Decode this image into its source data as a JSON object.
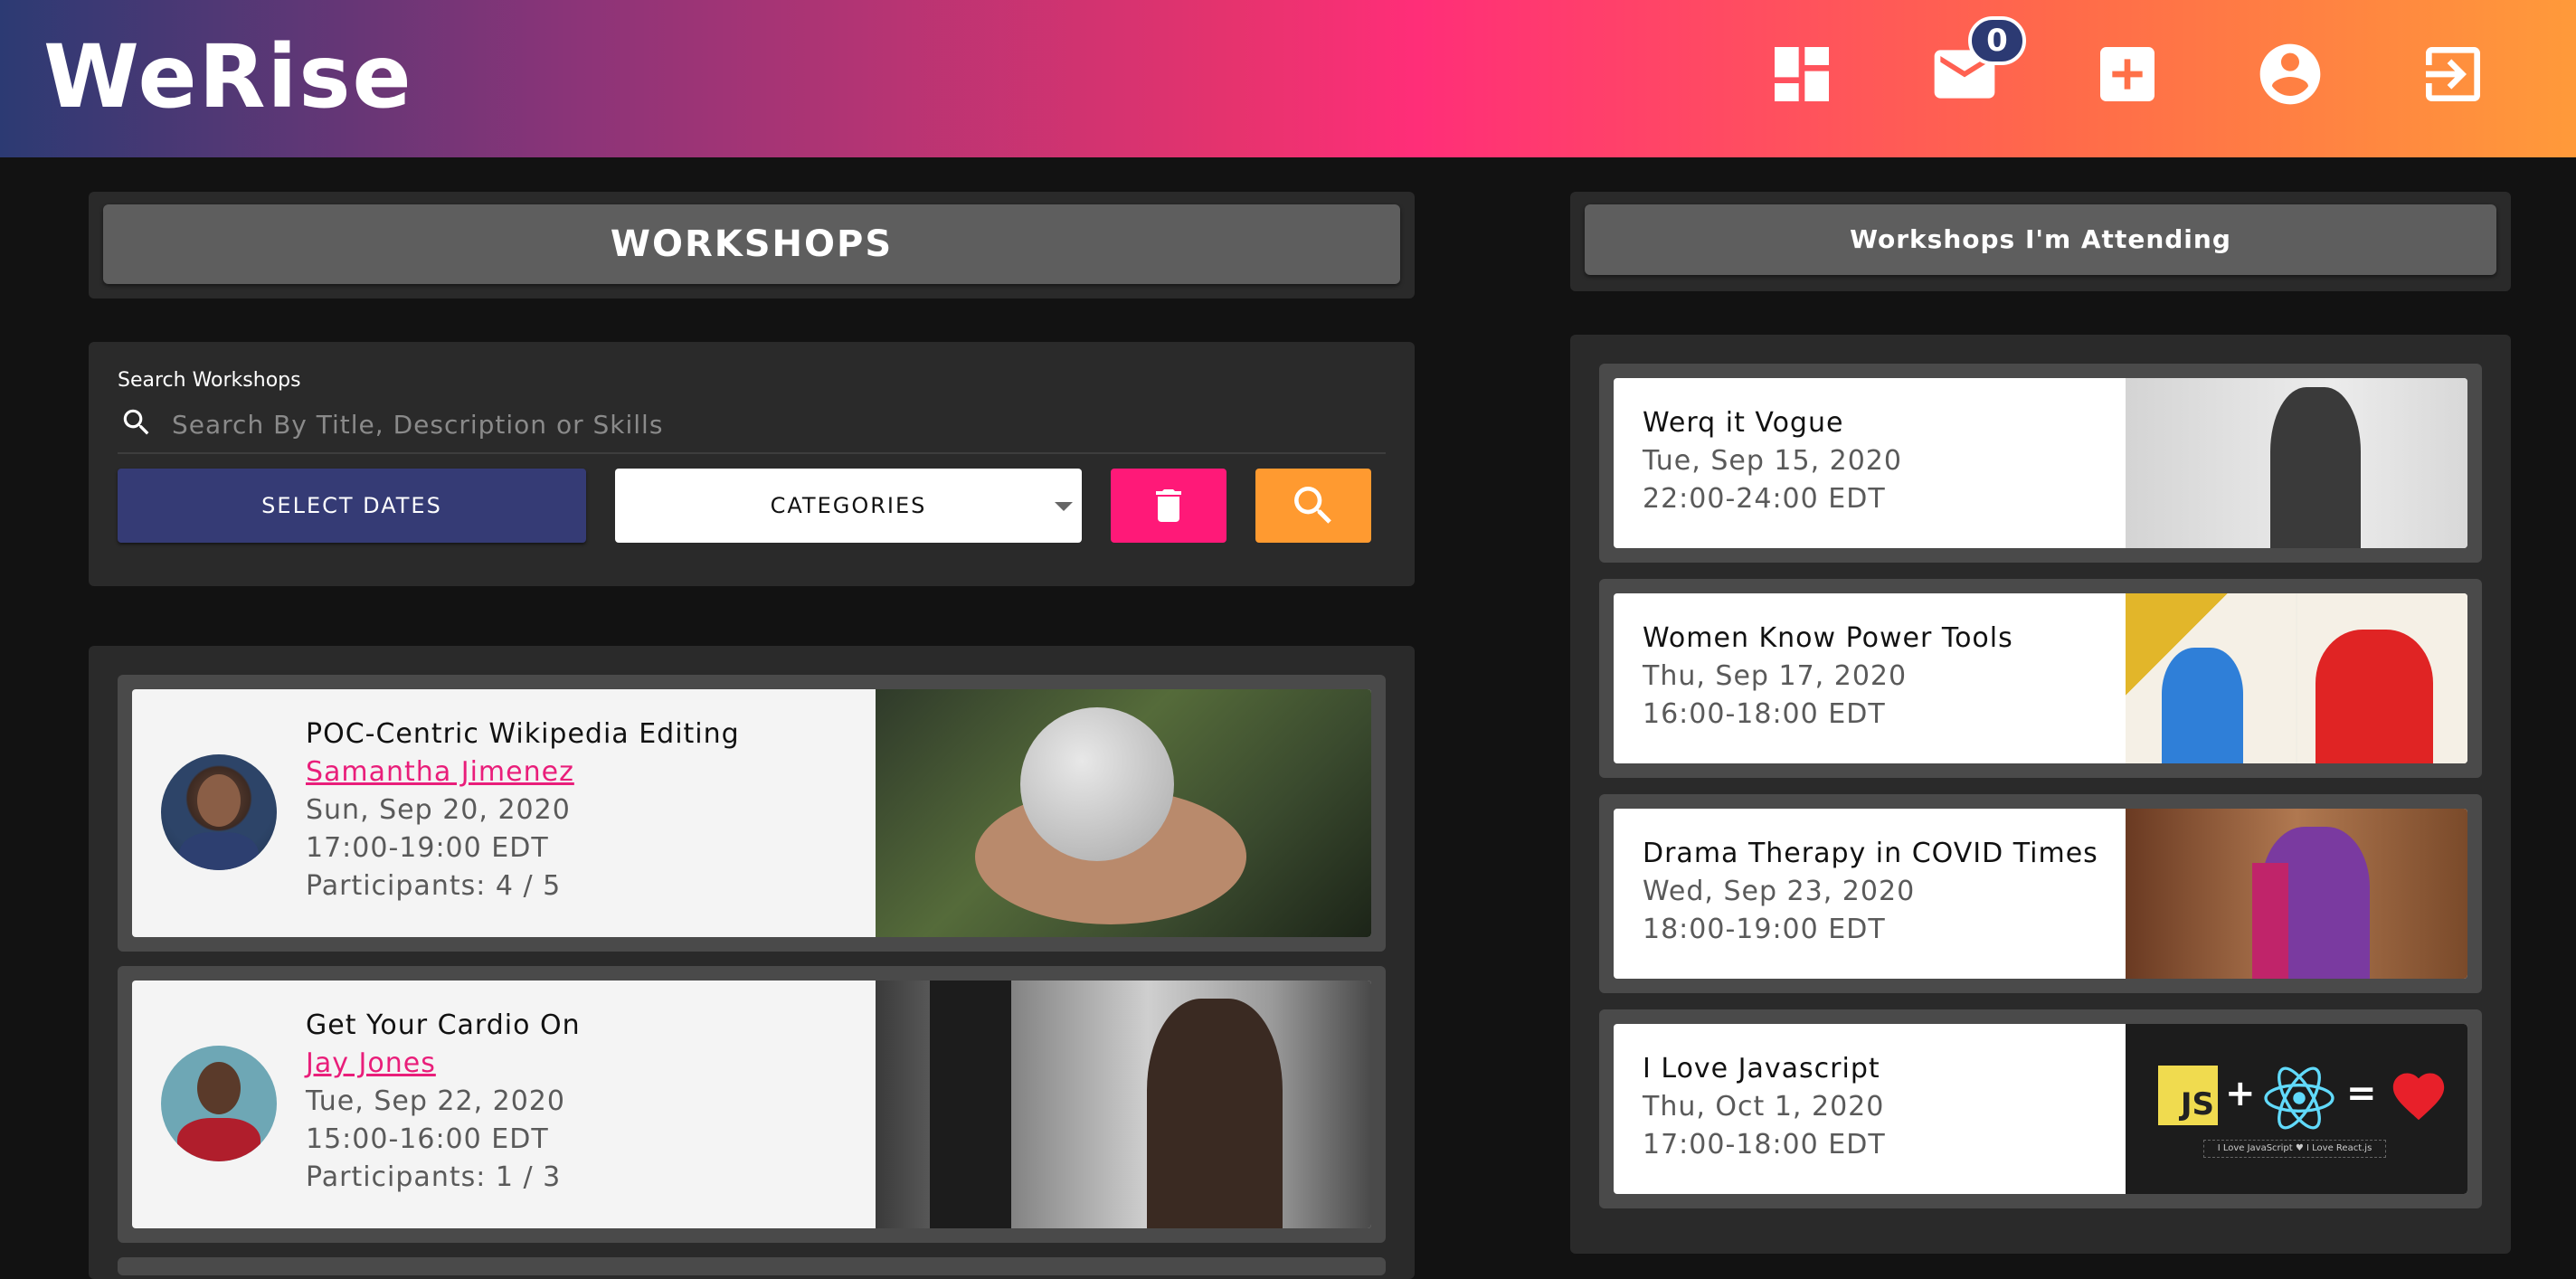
{
  "app": {
    "logo": "WeRise"
  },
  "nav": {
    "icons": [
      "dashboard-icon",
      "mail-icon",
      "add-icon",
      "account-icon",
      "logout-icon"
    ],
    "mail_badge": "0"
  },
  "workshops": {
    "title": "WORKSHOPS",
    "search": {
      "label": "Search Workshops",
      "placeholder": "Search By Title, Description or Skills",
      "value": ""
    },
    "select_dates_label": "SELECT DATES",
    "categories_label": "CATEGORIES",
    "list": [
      {
        "title": "POC-Centric Wikipedia Editing",
        "host": "Samantha Jimenez",
        "date": "Sun, Sep 20, 2020",
        "time": "17:00-19:00 EDT",
        "participants": "Participants: 4 / 5"
      },
      {
        "title": "Get Your Cardio On",
        "host": "Jay Jones",
        "date": "Tue, Sep 22, 2020",
        "time": "15:00-16:00 EDT",
        "participants": "Participants: 1 / 3"
      }
    ]
  },
  "attending": {
    "title": "Workshops I'm Attending",
    "list": [
      {
        "title": "Werq it Vogue",
        "date": "Tue, Sep 15, 2020",
        "time": "22:00-24:00 EDT"
      },
      {
        "title": "Women Know Power Tools",
        "date": "Thu, Sep 17, 2020",
        "time": "16:00-18:00 EDT"
      },
      {
        "title": "Drama Therapy in COVID Times",
        "date": "Wed, Sep 23, 2020",
        "time": "18:00-19:00 EDT"
      },
      {
        "title": "I Love Javascript",
        "date": "Thu, Oct 1, 2020",
        "time": "17:00-18:00 EDT"
      }
    ],
    "js_image": {
      "js": "JS",
      "caption": "I Love JavaScript ♥ I Love React.js"
    }
  },
  "colors": {
    "accent_navy": "#353b75",
    "accent_pink": "#ff1978",
    "accent_orange": "#ff9a30",
    "link_pink": "#e91e7a"
  }
}
